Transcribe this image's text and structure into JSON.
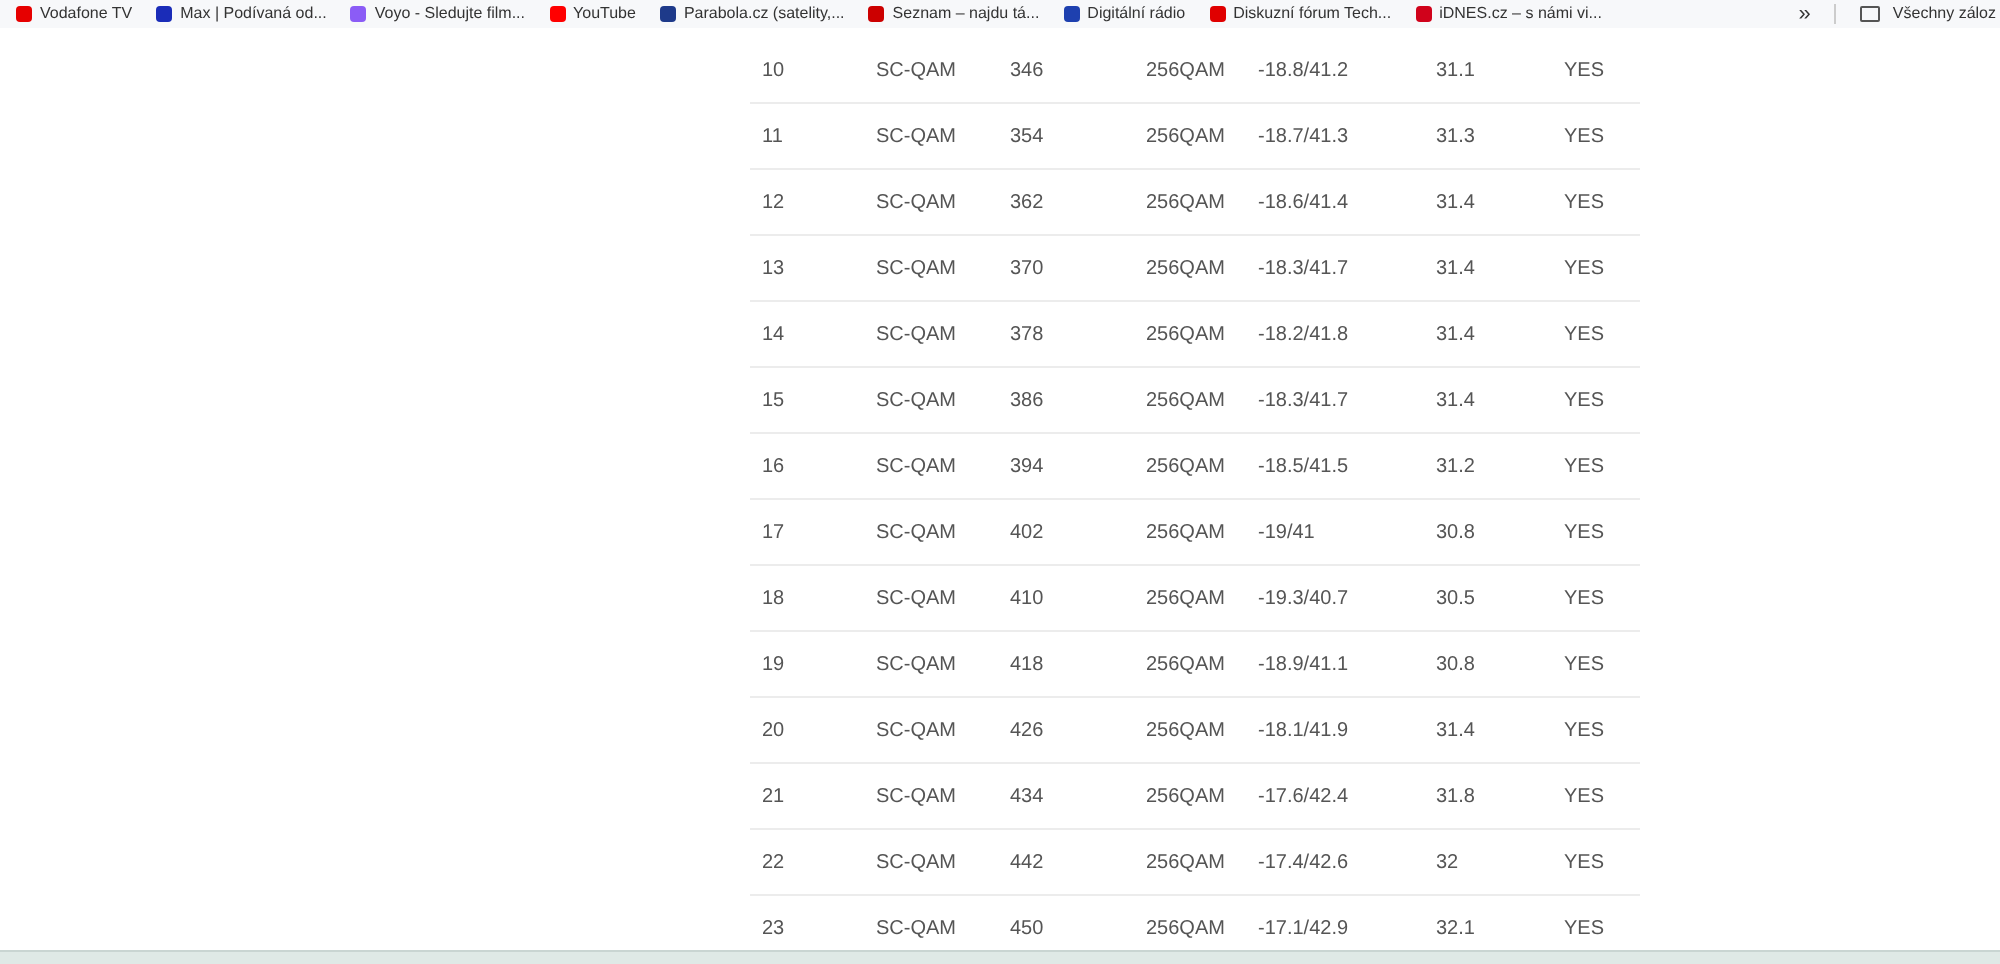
{
  "bookmarks": [
    {
      "label": "Vodafone TV",
      "color": "#e60000"
    },
    {
      "label": "Max | Podívaná od...",
      "color": "#1a2cb8"
    },
    {
      "label": "Voyo - Sledujte film...",
      "color": "#8b5cf6"
    },
    {
      "label": "YouTube",
      "color": "#ff0000"
    },
    {
      "label": "Parabola.cz (satelity,...",
      "color": "#1e3a8a"
    },
    {
      "label": "Seznam – najdu tá...",
      "color": "#cc0000"
    },
    {
      "label": "Digitální rádio",
      "color": "#1e40af"
    },
    {
      "label": "Diskuzní fórum Tech...",
      "color": "#e00000"
    },
    {
      "label": "iDNES.cz – s námi vi...",
      "color": "#d0021b"
    }
  ],
  "more": "»",
  "all_bookmarks": "Všechny záloz",
  "rows": [
    [
      "10",
      "SC-QAM",
      "346",
      "256QAM",
      "-18.8/41.2",
      "31.1",
      "YES"
    ],
    [
      "11",
      "SC-QAM",
      "354",
      "256QAM",
      "-18.7/41.3",
      "31.3",
      "YES"
    ],
    [
      "12",
      "SC-QAM",
      "362",
      "256QAM",
      "-18.6/41.4",
      "31.4",
      "YES"
    ],
    [
      "13",
      "SC-QAM",
      "370",
      "256QAM",
      "-18.3/41.7",
      "31.4",
      "YES"
    ],
    [
      "14",
      "SC-QAM",
      "378",
      "256QAM",
      "-18.2/41.8",
      "31.4",
      "YES"
    ],
    [
      "15",
      "SC-QAM",
      "386",
      "256QAM",
      "-18.3/41.7",
      "31.4",
      "YES"
    ],
    [
      "16",
      "SC-QAM",
      "394",
      "256QAM",
      "-18.5/41.5",
      "31.2",
      "YES"
    ],
    [
      "17",
      "SC-QAM",
      "402",
      "256QAM",
      "-19/41",
      "30.8",
      "YES"
    ],
    [
      "18",
      "SC-QAM",
      "410",
      "256QAM",
      "-19.3/40.7",
      "30.5",
      "YES"
    ],
    [
      "19",
      "SC-QAM",
      "418",
      "256QAM",
      "-18.9/41.1",
      "30.8",
      "YES"
    ],
    [
      "20",
      "SC-QAM",
      "426",
      "256QAM",
      "-18.1/41.9",
      "31.4",
      "YES"
    ],
    [
      "21",
      "SC-QAM",
      "434",
      "256QAM",
      "-17.6/42.4",
      "31.8",
      "YES"
    ],
    [
      "22",
      "SC-QAM",
      "442",
      "256QAM",
      "-17.4/42.6",
      "32",
      "YES"
    ],
    [
      "23",
      "SC-QAM",
      "450",
      "256QAM",
      "-17.1/42.9",
      "32.1",
      "YES"
    ]
  ]
}
